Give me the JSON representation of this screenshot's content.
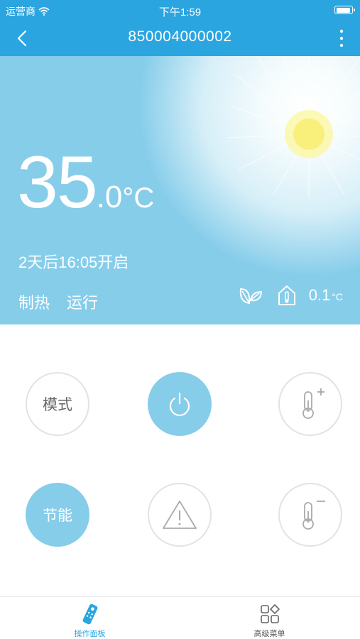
{
  "status_bar": {
    "carrier": "运营商",
    "time": "下午1:59"
  },
  "nav": {
    "title": "850004000002"
  },
  "hero": {
    "temp_int": "35",
    "temp_dec": ".0",
    "temp_unit": "°C",
    "schedule": "2天后16:05开启",
    "mode": "制热",
    "state": "运行",
    "indoor_value": "0.1",
    "indoor_unit": "°C"
  },
  "controls": {
    "mode_label": "模式",
    "eco_label": "节能"
  },
  "tabs": [
    {
      "label": "操作面板"
    },
    {
      "label": "高级菜单"
    }
  ],
  "colors": {
    "primary": "#2aa5e0",
    "hero_bg": "#86cdea",
    "button_border": "#e3e3e3"
  }
}
